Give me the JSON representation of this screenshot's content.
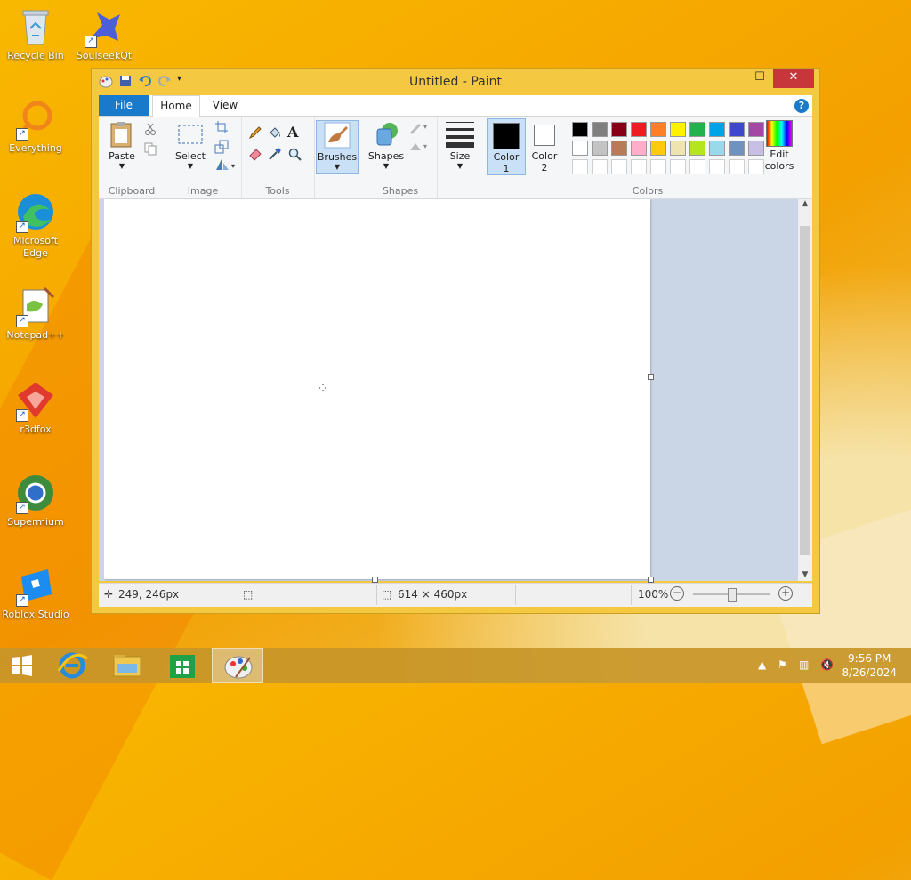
{
  "desktop": {
    "icons": [
      {
        "label": "Recycle Bin"
      },
      {
        "label": "SoulseekQt"
      },
      {
        "label": "Everything"
      },
      {
        "label": "Microsoft Edge"
      },
      {
        "label": "Notepad++"
      },
      {
        "label": "r3dfox"
      },
      {
        "label": "Supermium"
      },
      {
        "label": "Roblox Studio"
      }
    ]
  },
  "window": {
    "title": "Untitled - Paint",
    "tabs": {
      "file": "File",
      "home": "Home",
      "view": "View"
    },
    "help": "?"
  },
  "ribbon": {
    "clipboard": {
      "paste": "Paste",
      "label": "Clipboard"
    },
    "image": {
      "select": "Select",
      "label": "Image"
    },
    "tools": {
      "label": "Tools",
      "text_glyph": "A"
    },
    "brushes": {
      "label": "Brushes"
    },
    "shapes": {
      "shapes": "Shapes",
      "label": "Shapes"
    },
    "size": {
      "label": "Size"
    },
    "colors": {
      "color1": "Color",
      "color1_num": "1",
      "color2": "Color",
      "color2_num": "2",
      "edit": "Edit",
      "edit2": "colors",
      "label": "Colors",
      "row1": [
        "#000000",
        "#7f7f7f",
        "#880015",
        "#ed1c24",
        "#ff7f27",
        "#fff200",
        "#22b14c",
        "#00a2e8",
        "#3f48cc",
        "#a349a4"
      ],
      "row2": [
        "#ffffff",
        "#c3c3c3",
        "#b97a57",
        "#ffaec9",
        "#ffc90e",
        "#efe4b0",
        "#b5e61d",
        "#99d9ea",
        "#7092be",
        "#c8bfe7"
      ]
    }
  },
  "status": {
    "cursor_pos": "249, 246px",
    "canvas_size": "614 × 460px",
    "zoom": "100%",
    "zoom_level": 1.0
  },
  "taskbar": {
    "time": "9:56 PM",
    "date": "8/26/2024"
  },
  "colors": {
    "accent": "#1979ca",
    "close": "#c7363a",
    "window_frame": "#f5c842"
  }
}
